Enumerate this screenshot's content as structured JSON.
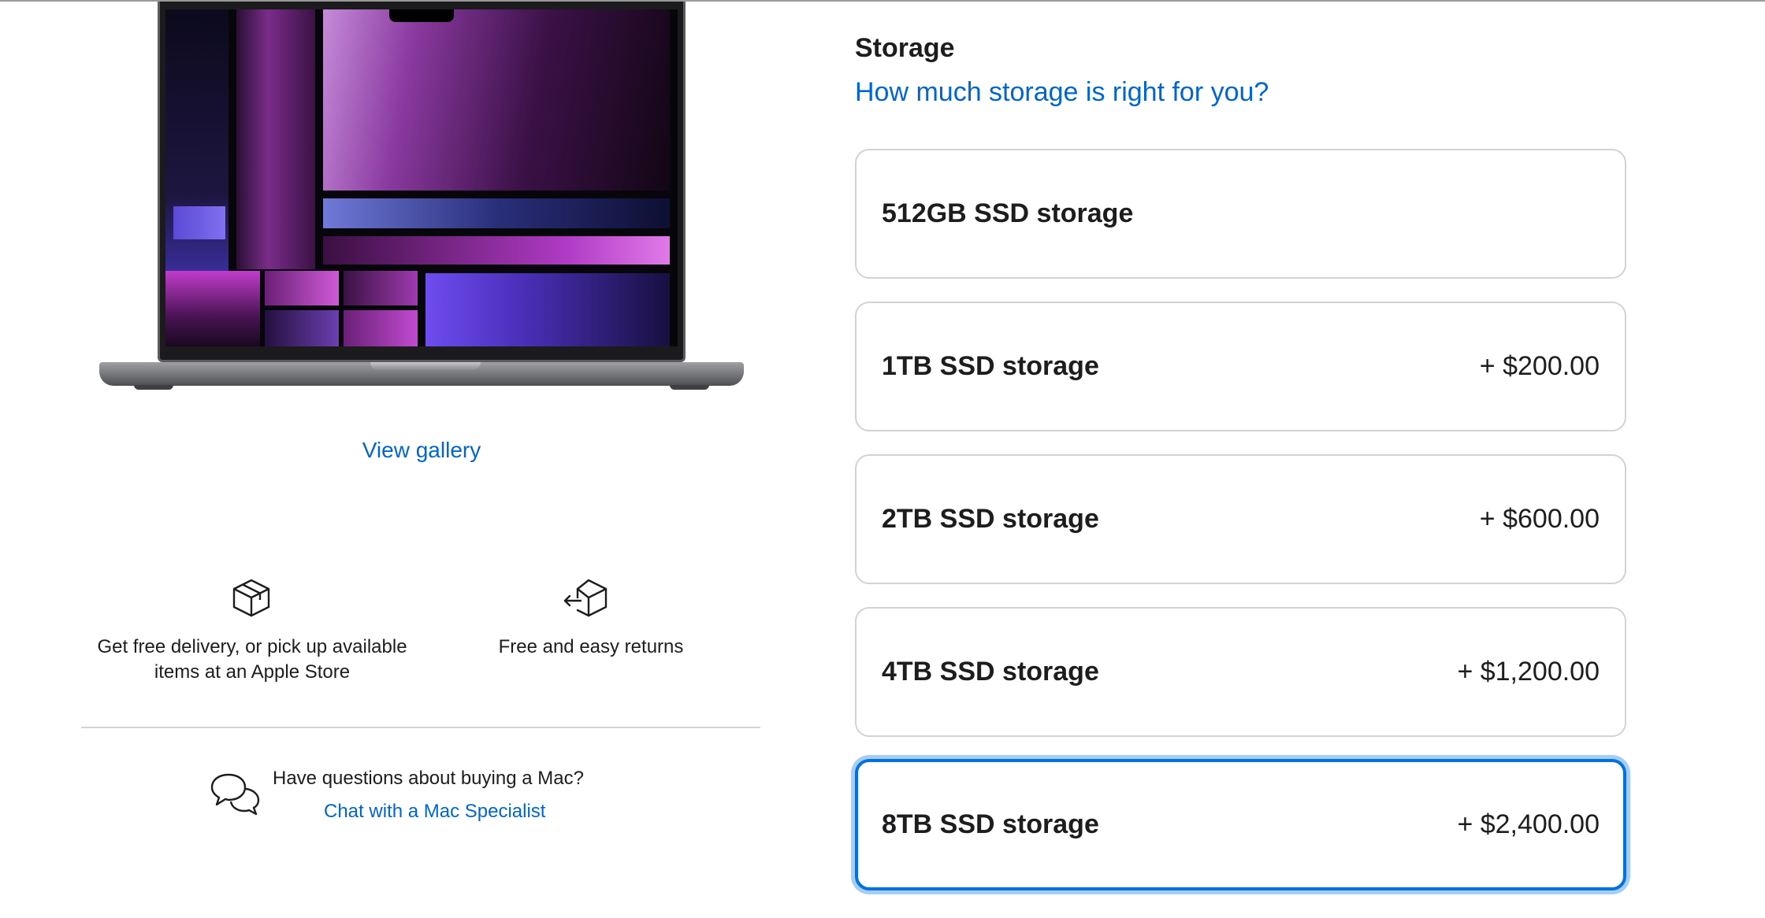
{
  "product": {
    "view_gallery": "View gallery"
  },
  "features": [
    {
      "icon": "box-icon",
      "text": "Get free delivery, or pick up available items at an Apple Store"
    },
    {
      "icon": "return-box-icon",
      "text": "Free and easy returns"
    }
  ],
  "help": {
    "icon": "chat-bubbles-icon",
    "question": "Have questions about buying a Mac?",
    "link": "Chat with a Mac Specialist"
  },
  "storage": {
    "title": "Storage",
    "help_link": "How much storage is right for you?",
    "selected": "8TB SSD storage",
    "options": [
      {
        "label": "512GB SSD storage",
        "price": ""
      },
      {
        "label": "1TB SSD storage",
        "price": "+ $200.00"
      },
      {
        "label": "2TB SSD storage",
        "price": "+ $600.00"
      },
      {
        "label": "4TB SSD storage",
        "price": "+ $1,200.00"
      },
      {
        "label": "8TB SSD storage",
        "price": "+ $2,400.00"
      }
    ]
  },
  "colors": {
    "accent": "#0071e3",
    "link": "#0066cc",
    "text": "#1d1d1f",
    "border": "#d2d2d7"
  }
}
